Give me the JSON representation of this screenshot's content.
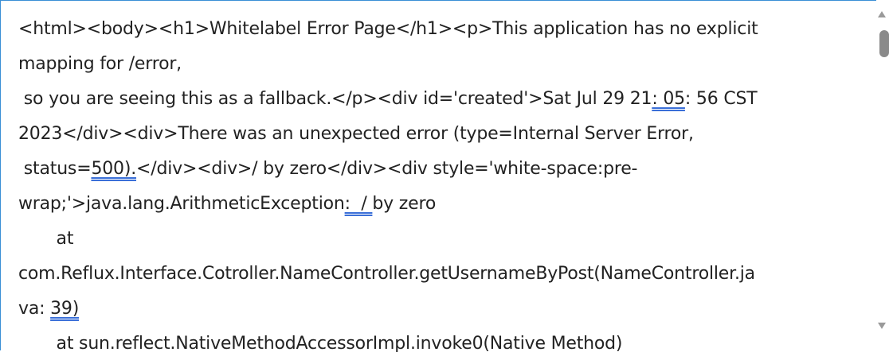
{
  "lines": [
    {
      "text": "<html><body><h1>Whitelabel Error Page</h1><p>This application has no explicit"
    },
    {
      "text": "mapping for /error,"
    },
    {
      "pre": " so you are seeing this as a fallback.</p><div id='created'>Sat Jul 29 21",
      "u": ": 05",
      "post": ": 56 CST"
    },
    {
      "text": "2023</div><div>There was an unexpected error (type=Internal Server Error,"
    },
    {
      "pre": " status=",
      "u": "500).",
      "post": "</div><div>/ by zero</div><div style='white-space:pre-"
    },
    {
      "pre": "wrap;'>java.lang.ArithmeticException",
      "u": ":  / ",
      "post": "by zero"
    },
    {
      "text": "       at"
    },
    {
      "text": "com.Reflux.Interface.Cotroller.NameController.getUsernameByPost(NameController.ja"
    },
    {
      "pre": "va: ",
      "u": "39)",
      "post": ""
    },
    {
      "text": "       at sun.reflect.NativeMethodAccessorImpl.invoke0(Native Method)"
    }
  ]
}
